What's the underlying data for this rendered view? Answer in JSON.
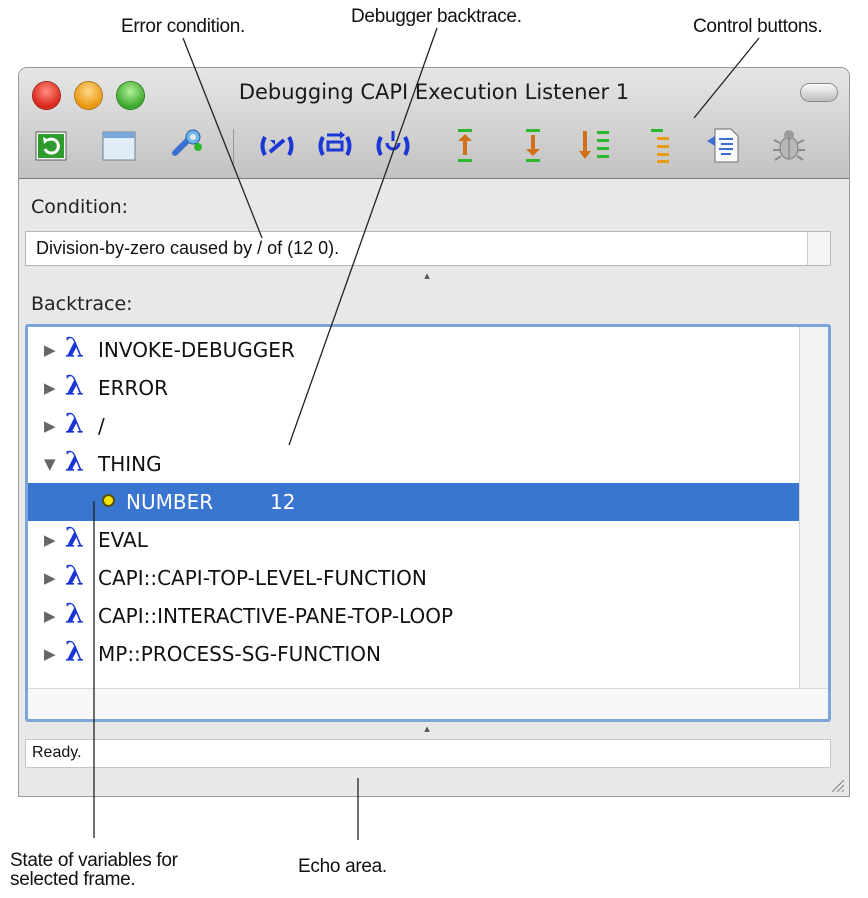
{
  "callouts": {
    "error_condition": "Error condition.",
    "debugger_backtrace": "Debugger backtrace.",
    "control_buttons": "Control buttons.",
    "state_of_variables": "State of variables for selected frame.",
    "echo_area": "Echo area."
  },
  "window": {
    "title": "Debugging CAPI Execution Listener 1",
    "toolbar_buttons": [
      {
        "icon": "refresh-icon",
        "color": "#2e9b2e"
      },
      {
        "icon": "window-icon",
        "color": "#7aa6d8"
      },
      {
        "icon": "tools-icon",
        "color": "#3b6fd0"
      },
      {
        "icon": "abort-icon",
        "color": "#1a36d6"
      },
      {
        "icon": "continue-icon",
        "color": "#1a36d6"
      },
      {
        "icon": "restart-icon",
        "color": "#1a36d6"
      },
      {
        "icon": "step-up-icon",
        "color": "#2eb82e"
      },
      {
        "icon": "step-down-icon",
        "color": "#2eb82e"
      },
      {
        "icon": "step-list-icon",
        "color": "#d97a1a"
      },
      {
        "icon": "step-bars-icon",
        "color": "#e89a1a"
      },
      {
        "icon": "document-icon",
        "color": "#3b6fd0"
      },
      {
        "icon": "bug-icon",
        "color": "#8a8a8a"
      }
    ]
  },
  "condition": {
    "label": "Condition:",
    "text": "Division-by-zero caused by / of (12 0)."
  },
  "backtrace": {
    "label": "Backtrace:",
    "frames": [
      {
        "name": "INVOKE-DEBUGGER",
        "expanded": false
      },
      {
        "name": "ERROR",
        "expanded": false
      },
      {
        "name": "/",
        "expanded": false
      },
      {
        "name": "THING",
        "expanded": true
      },
      {
        "name": "EVAL",
        "expanded": false
      },
      {
        "name": "CAPI::CAPI-TOP-LEVEL-FUNCTION",
        "expanded": false
      },
      {
        "name": "CAPI::INTERACTIVE-PANE-TOP-LOOP",
        "expanded": false
      },
      {
        "name": "MP::PROCESS-SG-FUNCTION",
        "expanded": false
      }
    ],
    "selected_variable": {
      "name": "NUMBER",
      "value": "12"
    }
  },
  "echo": {
    "text": "Ready."
  },
  "colors": {
    "lambda": "#1a36d6",
    "selection": "#3a75cf",
    "focus_ring": "#7da6d8"
  }
}
